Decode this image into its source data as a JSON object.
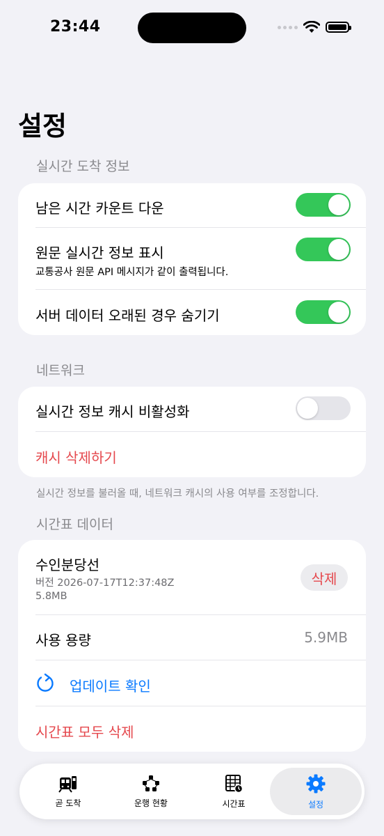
{
  "status_bar": {
    "time": "23:44"
  },
  "page_title": "설정",
  "realtime": {
    "header": "실시간 도착 정보",
    "countdown": {
      "label": "남은 시간 카운트 다운",
      "enabled": true
    },
    "raw_info": {
      "label": "원문 실시간 정보 표시",
      "subtitle": "교통공사 원문 API 메시지가 같이 출력됩니다.",
      "enabled": true
    },
    "hide_stale": {
      "label": "서버 데이터 오래된 경우 숨기기",
      "enabled": true
    }
  },
  "network": {
    "header": "네트워크",
    "disable_cache": {
      "label": "실시간 정보 캐시 비활성화",
      "enabled": false
    },
    "clear_cache": "캐시 삭제하기",
    "footnote": "실시간 정보를 불러올 때, 네트워크 캐시의 사용 여부를 조정합니다."
  },
  "timetable": {
    "header": "시간표 데이터",
    "line": {
      "name": "수인분당선",
      "version": "버전 2026-07-17T12:37:48Z",
      "size": "5.8MB",
      "delete_label": "삭제"
    },
    "usage": {
      "label": "사용 용량",
      "value": "5.9MB"
    },
    "update": "업데이트 확인",
    "delete_all": "시간표 모두 삭제"
  },
  "tabs": [
    {
      "label": "곧 도착",
      "icon": "tram-icon"
    },
    {
      "label": "운행 현황",
      "icon": "network-icon"
    },
    {
      "label": "시간표",
      "icon": "timetable-icon"
    },
    {
      "label": "설정",
      "icon": "gear-icon",
      "active": true
    }
  ],
  "colors": {
    "accent": "#0a7aff",
    "toggle_on": "#34c759",
    "destructive": "#e5484d",
    "background": "#f2f2f7"
  }
}
